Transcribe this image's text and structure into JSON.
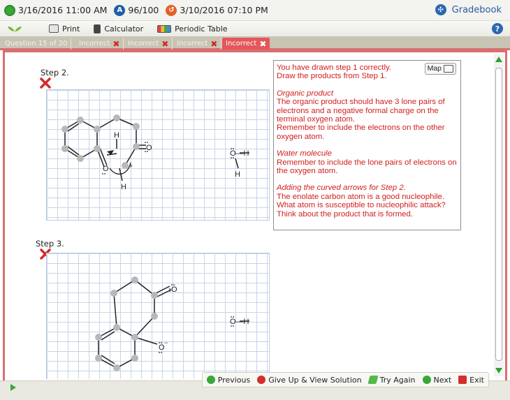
{
  "status": {
    "start_time": "3/16/2016 11:00 AM",
    "score": "96/100",
    "due_time": "3/10/2016 07:10 PM",
    "gradebook": "Gradebook"
  },
  "tools": {
    "print": "Print",
    "calculator": "Calculator",
    "periodic_table": "Periodic Table"
  },
  "tabs": {
    "question": "Question 15 of 20",
    "attempts": [
      "Incorrect",
      "Incorrect",
      "Incorrect",
      "Incorrect"
    ]
  },
  "steps": {
    "step2": "Step 2.",
    "step3": "Step 3."
  },
  "feedback": {
    "map": "Map",
    "intro1": "You have drawn step 1 correctly.",
    "intro2": "Draw the products from Step 1.",
    "h1": "Organic product",
    "p1": "The organic product should have 3 lone pairs of electrons and a negative formal charge on the terminal oxygen atom.",
    "p1b": "Remember to include the electrons on the other oxygen atom.",
    "h2": "Water molecule",
    "p2": "Remember to include the lone pairs of electrons on the oxygen atom.",
    "h3": "Adding the curved arrows for Step 2.",
    "p3a": "The enolate carbon atom is a good nucleophile.",
    "p3b": "What atom is susceptible to nucleophilic attack?",
    "p3c": "Think about the product that is formed."
  },
  "molecule_labels": {
    "h": "H",
    "o": "O",
    "oh": "O—H",
    "minus": "−",
    "plus": "+"
  },
  "nav": {
    "previous": "Previous",
    "give_up": "Give Up & View Solution",
    "try_again": "Try Again",
    "next": "Next",
    "exit": "Exit"
  },
  "colors": {
    "accent": "#d86f71",
    "error_text": "#cf1e1e",
    "link": "#2a5b9a"
  }
}
